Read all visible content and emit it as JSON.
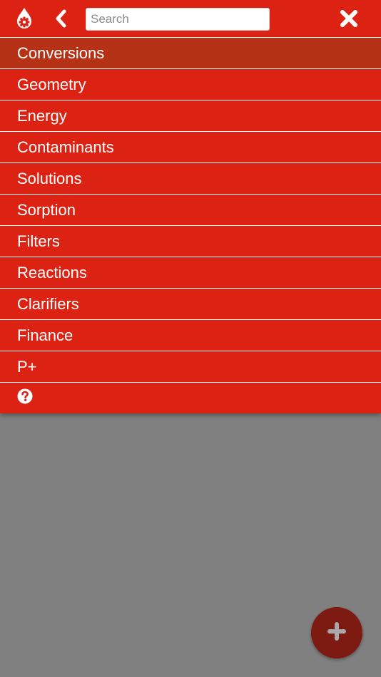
{
  "header": {
    "logo_icon": "water-drop-gear-icon",
    "back_icon": "chevron-left-icon",
    "close_icon": "close-x-icon",
    "search": {
      "placeholder": "Search",
      "value": ""
    }
  },
  "menu": {
    "active_index": 0,
    "items": [
      {
        "label": "Conversions"
      },
      {
        "label": "Geometry"
      },
      {
        "label": "Energy"
      },
      {
        "label": "Contaminants"
      },
      {
        "label": "Solutions"
      },
      {
        "label": "Sorption"
      },
      {
        "label": "Filters"
      },
      {
        "label": "Reactions"
      },
      {
        "label": "Clarifiers"
      },
      {
        "label": "Finance"
      },
      {
        "label": "P+"
      }
    ],
    "help_icon": "question-circle-icon"
  },
  "fab": {
    "icon": "plus-icon"
  },
  "colors": {
    "primary": "#dc2313",
    "active_item": "#b53217",
    "fab": "#7d1a11",
    "backdrop": "#808080"
  }
}
